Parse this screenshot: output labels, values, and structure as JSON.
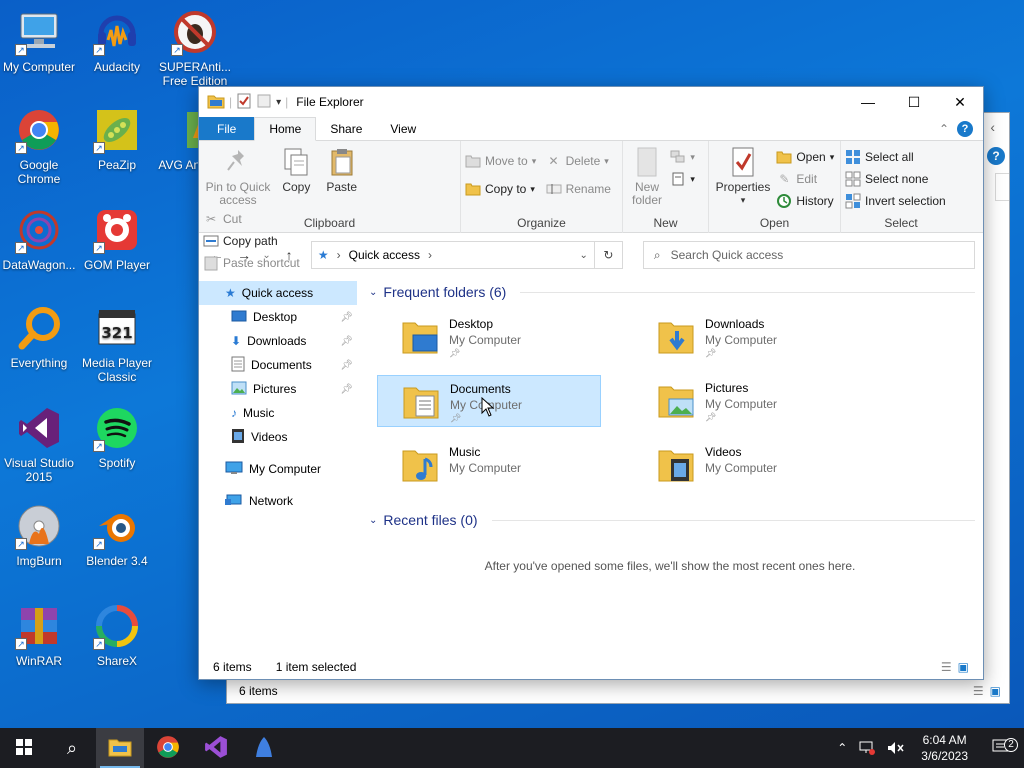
{
  "desktop": {
    "icons": [
      {
        "label": "My Computer",
        "icon": "computer-icon"
      },
      {
        "label": "Audacity",
        "icon": "audacity-icon"
      },
      {
        "label": "SUPERAnti... Free Edition",
        "icon": "superantispyware-icon"
      },
      {
        "label": "Google Chrome",
        "icon": "chrome-icon"
      },
      {
        "label": "PeaZip",
        "icon": "peazip-icon"
      },
      {
        "label": "AVG An... Fre",
        "icon": "avg-icon"
      },
      {
        "label": "DataWagon...",
        "icon": "datawagon-icon"
      },
      {
        "label": "GOM Player",
        "icon": "gom-player-icon"
      },
      {
        "label": "Everything",
        "icon": "everything-icon"
      },
      {
        "label": "Media Player Classic",
        "icon": "media-player-classic-icon"
      },
      {
        "label": "Visual Studio 2015",
        "icon": "visual-studio-icon"
      },
      {
        "label": "Spotify",
        "icon": "spotify-icon"
      },
      {
        "label": "ImgBurn",
        "icon": "imgburn-icon"
      },
      {
        "label": "Blender 3.4",
        "icon": "blender-icon"
      },
      {
        "label": "WinRAR",
        "icon": "winrar-icon"
      },
      {
        "label": "ShareX",
        "icon": "sharex-icon"
      }
    ]
  },
  "window": {
    "title": "File Explorer",
    "tabs": {
      "file": "File",
      "home": "Home",
      "share": "Share",
      "view": "View"
    },
    "ribbon": {
      "clipboard": {
        "label": "Clipboard",
        "pin": "Pin to Quick access",
        "copy": "Copy",
        "paste": "Paste",
        "cut": "Cut",
        "copy_path": "Copy path",
        "paste_shortcut": "Paste shortcut"
      },
      "organize": {
        "label": "Organize",
        "move_to": "Move to",
        "copy_to": "Copy to",
        "delete": "Delete",
        "rename": "Rename"
      },
      "new": {
        "label": "New",
        "new_folder": "New folder"
      },
      "open": {
        "label": "Open",
        "properties": "Properties",
        "open": "Open",
        "edit": "Edit",
        "history": "History"
      },
      "select": {
        "label": "Select",
        "select_all": "Select all",
        "select_none": "Select none",
        "invert": "Invert selection"
      }
    },
    "address": {
      "location": "Quick access",
      "search_placeholder": "Search Quick access"
    },
    "nav": {
      "quick_access": "Quick access",
      "desktop": "Desktop",
      "downloads": "Downloads",
      "documents": "Documents",
      "pictures": "Pictures",
      "music": "Music",
      "videos": "Videos",
      "my_computer": "My Computer",
      "network": "Network"
    },
    "frequent_header": "Frequent folders (6)",
    "folders": [
      {
        "name": "Desktop",
        "location": "My Computer",
        "pinned": true
      },
      {
        "name": "Downloads",
        "location": "My Computer",
        "pinned": true
      },
      {
        "name": "Documents",
        "location": "My Computer",
        "pinned": true
      },
      {
        "name": "Pictures",
        "location": "My Computer",
        "pinned": true
      },
      {
        "name": "Music",
        "location": "My Computer",
        "pinned": false
      },
      {
        "name": "Videos",
        "location": "My Computer",
        "pinned": false
      }
    ],
    "recent_header": "Recent files (0)",
    "recent_empty": "After you've opened some files, we'll show the most recent ones here.",
    "status": {
      "count": "6 items",
      "selected": "1 item selected"
    }
  },
  "back_window": {
    "status_count": "6 items"
  },
  "taskbar": {
    "time": "6:04 AM",
    "date": "3/6/2023",
    "notification_count": "2"
  },
  "colors": {
    "desktop": "#0a6acf",
    "file_tab": "#1979ca",
    "selection": "#cce8ff",
    "taskbar": "#1c1d22"
  }
}
